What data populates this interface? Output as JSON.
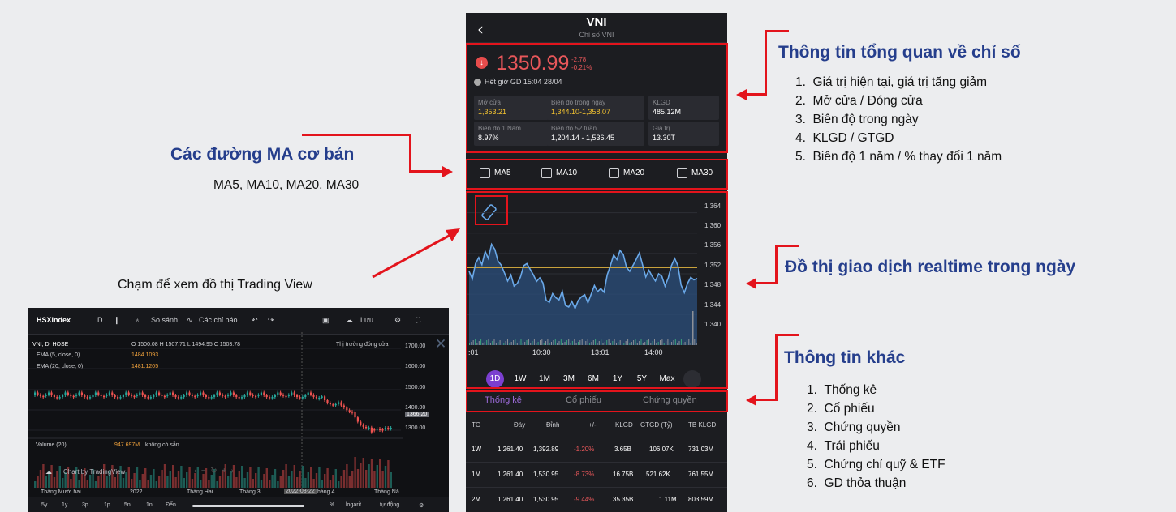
{
  "overview": {
    "title": "Thông tin tổng quan về chỉ số",
    "items": [
      "Giá trị hiện tại, giá trị tăng giảm",
      "Mở cửa / Đóng cửa",
      "Biên độ trong ngày",
      "KLGD / GTGD",
      "Biên độ 1 năm / % thay đổi 1 năm"
    ]
  },
  "ma_section": {
    "title": "Các đường MA cơ bản",
    "subtitle": "MA5, MA10, MA20, MA30"
  },
  "chart_section": {
    "title": "Đồ thị giao dịch realtime trong ngày"
  },
  "tv_caption": "Chạm để xem đồ thị Trading View",
  "other": {
    "title": "Thông tin khác",
    "items": [
      "Thống kê",
      "Cổ phiếu",
      "Chứng quyền",
      "Trái phiếu",
      "Chứng chỉ quỹ & ETF",
      "GD thỏa thuận"
    ]
  },
  "phone": {
    "title": "VNI",
    "subtitle": "Chỉ số VNI",
    "price": "1350.99",
    "change": "-2.78",
    "change_pct": "-0.21%",
    "status": "Hết giờ GD 15:04 28/04",
    "stats": [
      {
        "label": "Mở cửa",
        "value": "1,353.21",
        "color": "#f2c230"
      },
      {
        "label": "Biên độ trong ngày",
        "value": "1,344.10-1,358.07",
        "color": "#f2c230"
      },
      {
        "label": "KLGD",
        "value": "485.12M",
        "color": "#ffffff"
      },
      {
        "label": "Biên độ 1 Năm",
        "value": "8.97%",
        "color": "#ffffff"
      },
      {
        "label": "Biên độ 52 tuần",
        "value": "1,204.14 - 1,536.45",
        "color": "#ffffff"
      },
      {
        "label": "Giá trị",
        "value": "13.30T",
        "color": "#ffffff"
      }
    ],
    "ma": [
      "MA5",
      "MA10",
      "MA20",
      "MA30"
    ],
    "y_ticks": [
      "1,364",
      "1,360",
      "1,356",
      "1,352",
      "1,348",
      "1,344",
      "1,340"
    ],
    "x_ticks": [
      ":01",
      "10:30",
      "13:01",
      "14:00"
    ],
    "ranges": [
      "1D",
      "1W",
      "1M",
      "3M",
      "6M",
      "1Y",
      "5Y",
      "Max"
    ],
    "active_range": "1D",
    "tabs": [
      "Thống kê",
      "Cổ phiếu",
      "Chứng quyền"
    ],
    "table": {
      "headers": [
        "TG",
        "Đáy",
        "Đỉnh",
        "+/-",
        "KLGD",
        "GTGD (Tỷ)",
        "TB KLGD"
      ],
      "rows": [
        [
          "1W",
          "1,261.40",
          "1,392.89",
          "-1.20%",
          "3.65B",
          "106.07K",
          "731.03M"
        ],
        [
          "1M",
          "1,261.40",
          "1,530.95",
          "-8.73%",
          "16.75B",
          "521.62K",
          "761.55M"
        ],
        [
          "2M",
          "1,261.40",
          "1,530.95",
          "-9.44%",
          "35.35B",
          "1.11M",
          "803.59M"
        ]
      ]
    }
  },
  "chart_data": {
    "type": "area",
    "title": "",
    "xlabel": "",
    "ylabel": "",
    "ylim": [
      1338,
      1366
    ],
    "y_ticks": [
      1364,
      1360,
      1356,
      1352,
      1348,
      1344,
      1340
    ],
    "x_tick_labels": [
      ":01",
      "10:30",
      "13:01",
      "14:00"
    ],
    "reference_line": 1353.2,
    "values": [
      1352.5,
      1351,
      1354,
      1355.2,
      1353.8,
      1356.4,
      1355,
      1357.8,
      1356.8,
      1354.5,
      1353.7,
      1352.2,
      1350.6,
      1351.8,
      1349.6,
      1350.1,
      1351.4,
      1353.6,
      1354,
      1352.9,
      1351.8,
      1350.5,
      1351.2,
      1350.2,
      1346.8,
      1346.4,
      1348.1,
      1347.3,
      1346.9,
      1348.6,
      1345.8,
      1345.5,
      1346.6,
      1345.2,
      1346.8,
      1347.5,
      1347.9,
      1346.3,
      1348,
      1349.7,
      1348.5,
      1349.1,
      1348.4,
      1351.8,
      1353.6,
      1355.7,
      1354.8,
      1356.6,
      1355.8,
      1353.3,
      1352.5,
      1353.6,
      1354.8,
      1356.1,
      1353.8,
      1351.4,
      1352.7,
      1351.5,
      1350.6,
      1352,
      1351.5,
      1349.6,
      1351.2,
      1353.6,
      1355,
      1353.6,
      1349.8,
      1348.3,
      1350.1,
      1351.3,
      1350.8,
      1351.1
    ],
    "colors": {
      "line": "#6aa8e8",
      "fill": "#2b4f7c",
      "reference": "#c9a23c"
    }
  },
  "tv": {
    "symbol_box": "HSXIndex",
    "interval": "D",
    "compare": "So sánh",
    "indicators": "Các chỉ báo",
    "save": "Lưu",
    "series_title": "VNI, D, HOSE",
    "ohlc": "O 1500.08  H 1507.71  L 1494.95  C 1503.78",
    "market_status": "Thị trường đóng cửa",
    "ema5_label": "EMA (5, close, 0)",
    "ema5_value": "1484.1093",
    "ema20_label": "EMA (20, close, 0)",
    "ema20_value": "1481.1205",
    "price_ticks": [
      "1700.00",
      "1600.00",
      "1500.00",
      "1400.00",
      "1300.00"
    ],
    "last_price": "1366.20",
    "volume_label": "Volume (20)",
    "volume_value": "947.697M",
    "volume_note": "không có sẵn",
    "brand": "Chart by TradingView",
    "x_ticks": [
      "Tháng Mười hai",
      "2022",
      "Tháng Hai",
      "Tháng 3",
      "2022-03-22",
      "háng 4",
      "Tháng Nă"
    ],
    "bottom_items": [
      "5y",
      "1y",
      "3p",
      "1p",
      "5n",
      "1n",
      "Đến...",
      "%",
      "logarit",
      "tự động"
    ]
  }
}
